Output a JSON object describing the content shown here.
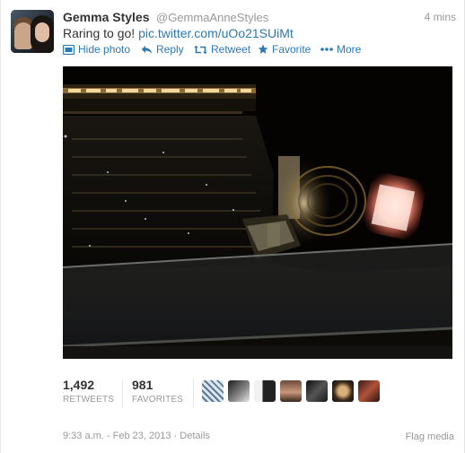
{
  "tweet": {
    "fullname": "Gemma Styles",
    "username": "@GemmaAnneStyles",
    "time_ago": "4 mins",
    "text": "Raring to go!",
    "link": "pic.twitter.com/uOo21SUiMt"
  },
  "actions": {
    "hide_photo": "Hide photo",
    "reply": "Reply",
    "retweet": "Retweet",
    "favorite": "Favorite",
    "more": "More"
  },
  "stats": {
    "retweets_count": "1,492",
    "retweets_label": "RETWEETS",
    "favorites_count": "981",
    "favorites_label": "FAVORITES"
  },
  "footer": {
    "timestamp": "9:33 a.m. - Feb 23, 2013",
    "separator": "·",
    "details": "Details",
    "flag": "Flag media"
  },
  "colors": {
    "link": "#2a79b6",
    "muted": "#999999",
    "text": "#333333"
  },
  "media": {
    "icon": "concert-photo"
  }
}
